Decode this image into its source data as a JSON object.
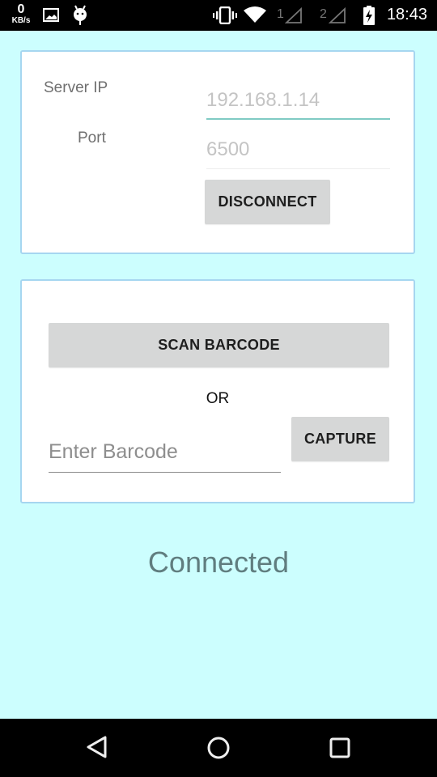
{
  "status_bar": {
    "net_speed_value": "0",
    "net_speed_unit": "KB/s",
    "icons": [
      "image-icon",
      "android-icon",
      "vibrate-icon",
      "wifi-icon",
      "signal-sim1-icon",
      "signal-sim2-icon",
      "battery-charging-icon"
    ],
    "sim1_label": "1",
    "sim2_label": "2",
    "time": "18:43"
  },
  "connection": {
    "server_ip_label": "Server IP",
    "server_ip_value": "192.168.1.14",
    "port_label": "Port",
    "port_value": "6500",
    "disconnect_label": "DISCONNECT"
  },
  "barcode": {
    "scan_label": "SCAN BARCODE",
    "or_label": "OR",
    "input_placeholder": "Enter Barcode",
    "input_value": "",
    "capture_label": "CAPTURE"
  },
  "status": {
    "text": "Connected"
  },
  "colors": {
    "background": "#ccfefe",
    "card_border": "#a6d6f0",
    "focus_underline": "#80cbc4",
    "button_bg": "#d6d7d7",
    "status_text": "#607d7f"
  },
  "nav_bar": {
    "buttons": [
      "back",
      "home",
      "recents"
    ]
  }
}
